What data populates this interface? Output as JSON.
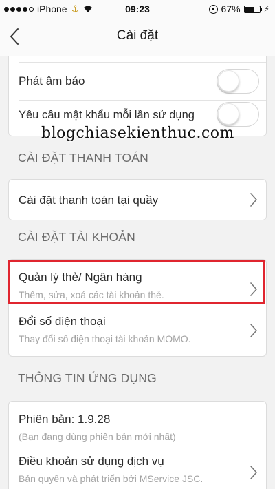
{
  "status_bar": {
    "carrier": "iPhone",
    "time": "09:23",
    "battery": "67%",
    "battery_level": 0.67,
    "signal_bars_filled": 4,
    "signal_bars_total": 5
  },
  "nav": {
    "title": "Cài đặt",
    "back_icon": "chevron-left-icon"
  },
  "notifications": {
    "sound_label": "Phát âm báo",
    "sound_enabled": false,
    "password_label": "Yêu cầu mật khẩu mỗi lần sử dụng",
    "password_enabled": false
  },
  "watermark": "blogchiasekienthuc.com",
  "payment_section": {
    "header": "CÀI ĐẶT THANH TOÁN",
    "item_label": "Cài đặt thanh toán tại quầy"
  },
  "account_section": {
    "header": "CÀI ĐẶT TÀI KHOẢN",
    "items": [
      {
        "title": "Quản lý thẻ/ Ngân hàng",
        "subtitle": "Thêm, sửa, xoá các tài khoản thẻ."
      },
      {
        "title": "Đổi số điện thoại",
        "subtitle": "Thay đổi số điện thoại tài khoản MOMO."
      }
    ]
  },
  "app_info_section": {
    "header": "THÔNG TIN ỨNG DỤNG",
    "version_label": "Phiên bản: 1.9.28",
    "version_note": "(Bạn đang dùng phiên bản mới nhất)",
    "terms_title": "Điều khoản sử dụng dịch vụ",
    "terms_subtitle": "Bản quyền và phát triển bởi MService JSC."
  },
  "colors": {
    "highlight": "#e0252f",
    "background": "#f2f2f2"
  }
}
